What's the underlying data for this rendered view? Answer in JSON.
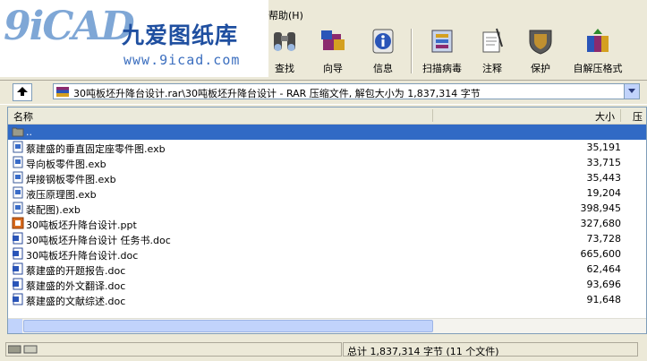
{
  "watermark": {
    "mark": "9iCAD",
    "name": "九爱图纸库",
    "url": "www.9icad.com"
  },
  "menu": {
    "help": "帮助(H)"
  },
  "toolbar": {
    "buttons": [
      {
        "label": "查找",
        "icon": "binoculars-icon"
      },
      {
        "label": "向导",
        "icon": "wizard-icon"
      },
      {
        "label": "信息",
        "icon": "info-icon"
      },
      {
        "label": "扫描病毒",
        "icon": "virus-scan-icon"
      },
      {
        "label": "注释",
        "icon": "comment-icon"
      },
      {
        "label": "保护",
        "icon": "shield-icon"
      },
      {
        "label": "自解压格式",
        "icon": "sfx-icon"
      }
    ]
  },
  "path": {
    "text": "30吨板坯升降台设计.rar\\30吨板坯升降台设计 - RAR 压缩文件, 解包大小为 1,837,314 字节"
  },
  "columns": {
    "name": "名称",
    "size": "大小",
    "packed": "压"
  },
  "files": [
    {
      "name": "..",
      "size": "",
      "type": "folder"
    },
    {
      "name": "蔡建盛的垂直固定座零件图.exb",
      "size": "35,191",
      "type": "exb"
    },
    {
      "name": "导向板零件图.exb",
      "size": "33,715",
      "type": "exb"
    },
    {
      "name": "焊接钢板零件图.exb",
      "size": "35,443",
      "type": "exb"
    },
    {
      "name": "液压原理图.exb",
      "size": "19,204",
      "type": "exb"
    },
    {
      "name": "装配图).exb",
      "size": "398,945",
      "type": "exb"
    },
    {
      "name": "30吨板坯升降台设计.ppt",
      "size": "327,680",
      "type": "ppt"
    },
    {
      "name": "30吨板坯升降台设计 任务书.doc",
      "size": "73,728",
      "type": "doc"
    },
    {
      "name": "30吨板坯升降台设计.doc",
      "size": "665,600",
      "type": "doc"
    },
    {
      "name": "蔡建盛的开题报告.doc",
      "size": "62,464",
      "type": "doc"
    },
    {
      "name": "蔡建盛的外文翻译.doc",
      "size": "93,696",
      "type": "doc"
    },
    {
      "name": "蔡建盛的文献综述.doc",
      "size": "91,648",
      "type": "doc"
    }
  ],
  "status": {
    "total": "总计 1,837,314 字节 (11 个文件)"
  },
  "colors": {
    "selection": "#316ac5",
    "panel": "#ece9d8",
    "border": "#7f9db9"
  }
}
